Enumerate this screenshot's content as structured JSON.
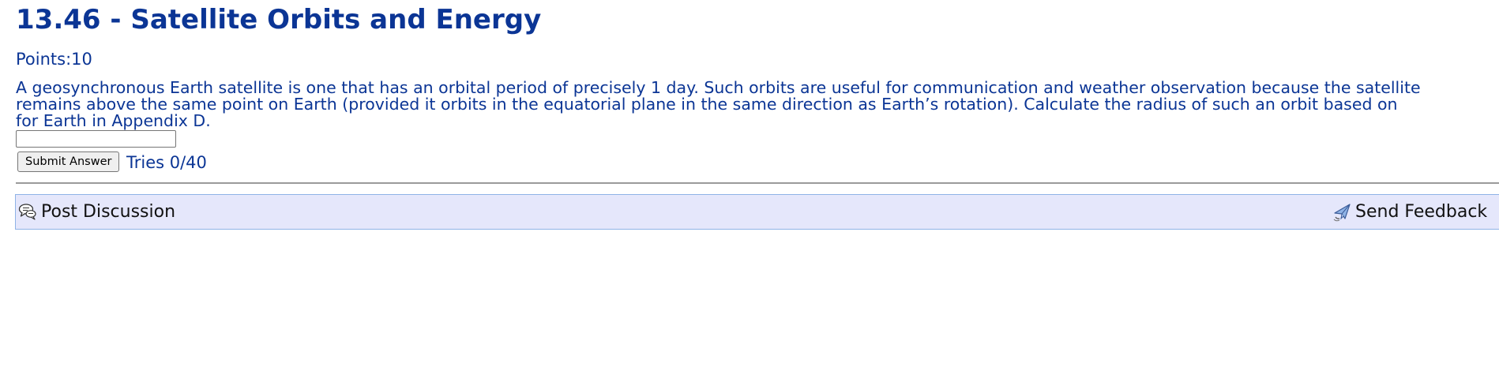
{
  "problem": {
    "title": "13.46 - Satellite Orbits and Energy",
    "points": "Points:10",
    "question_lines": [
      "A geosynchronous Earth satellite is one that has an orbital period of precisely 1 day. Such orbits are useful for communication and weather observation because the satellite",
      "remains above the same point on Earth (provided it orbits in the equatorial plane in the same direction as Earth’s rotation). Calculate the radius of such an orbit based on",
      "for Earth in Appendix D."
    ]
  },
  "answer": {
    "value": "",
    "placeholder": "",
    "submit_label": "Submit Answer",
    "tries": "Tries 0/40"
  },
  "footer": {
    "post_discussion_label": "Post Discussion",
    "post_discussion_icon": "speech-bubbles-icon",
    "send_feedback_label": "Send Feedback",
    "send_feedback_icon": "feedback-send-icon",
    "bar_background": "#e5e7fb",
    "bar_border": "#8fb3e6"
  },
  "colors": {
    "heading": "#0b3595",
    "text": "#0b3595"
  }
}
